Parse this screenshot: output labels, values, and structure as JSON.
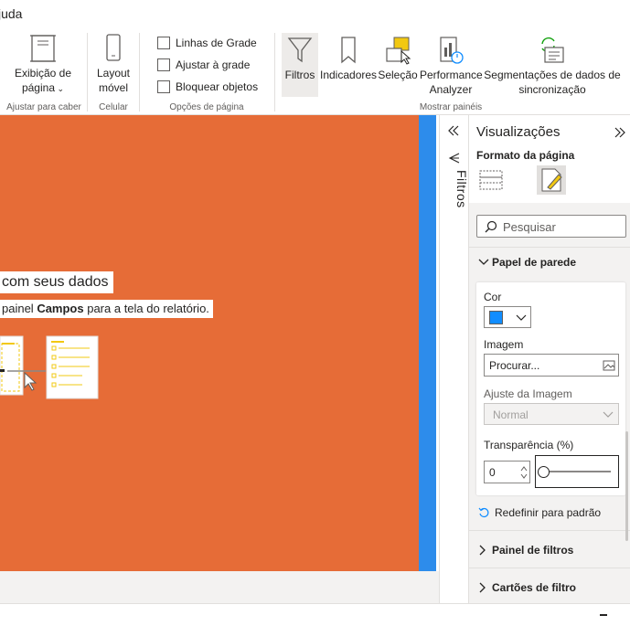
{
  "menu": {
    "help_label": "juda"
  },
  "ribbon": {
    "page_view": {
      "label_line1": "Exibição de",
      "label_line2": "página"
    },
    "mobile_layout": {
      "label_line1": "Layout",
      "label_line2": "móvel"
    },
    "options": {
      "gridlines": "Linhas de Grade",
      "snap_to_grid": "Ajustar à grade",
      "lock_objects": "Bloquear objetos"
    },
    "filters_label": "Filtros",
    "bookmarks_label": "Indicadores",
    "selection_label": "Seleção",
    "performance": {
      "label_line1": "Performance",
      "label_line2": "Analyzer"
    },
    "sync_slicers": {
      "label_line1": "Segmentações de dados de",
      "label_line2": "sincronização"
    },
    "group_labels": {
      "scale_to_fit": "Ajustar para caber",
      "mobile": "Celular",
      "page_options": "Opções de página",
      "show_panes": "Mostrar painéis"
    }
  },
  "canvas": {
    "background_color": "#e66c37",
    "title": "com seus dados",
    "subtitle_before": "painel ",
    "subtitle_bold": "Campos",
    "subtitle_after": " para a tela do relatório."
  },
  "filters_pane": {
    "label": "Filtros"
  },
  "visualizations": {
    "title": "Visualizações",
    "subtitle": "Formato da página",
    "search_placeholder": "Pesquisar",
    "wallpaper": {
      "header": "Papel de parede",
      "color_label": "Cor",
      "color_value": "#118dff",
      "image_label": "Imagem",
      "image_browse": "Procurar...",
      "image_fit_label": "Ajuste da Imagem",
      "image_fit_value": "Normal",
      "transparency_label": "Transparência (%)",
      "transparency_value": "0",
      "slider_value_fraction": 0
    },
    "reset_label": "Redefinir para padrão",
    "filter_pane_section": "Painel de filtros",
    "filter_cards_section": "Cartões de filtro"
  }
}
